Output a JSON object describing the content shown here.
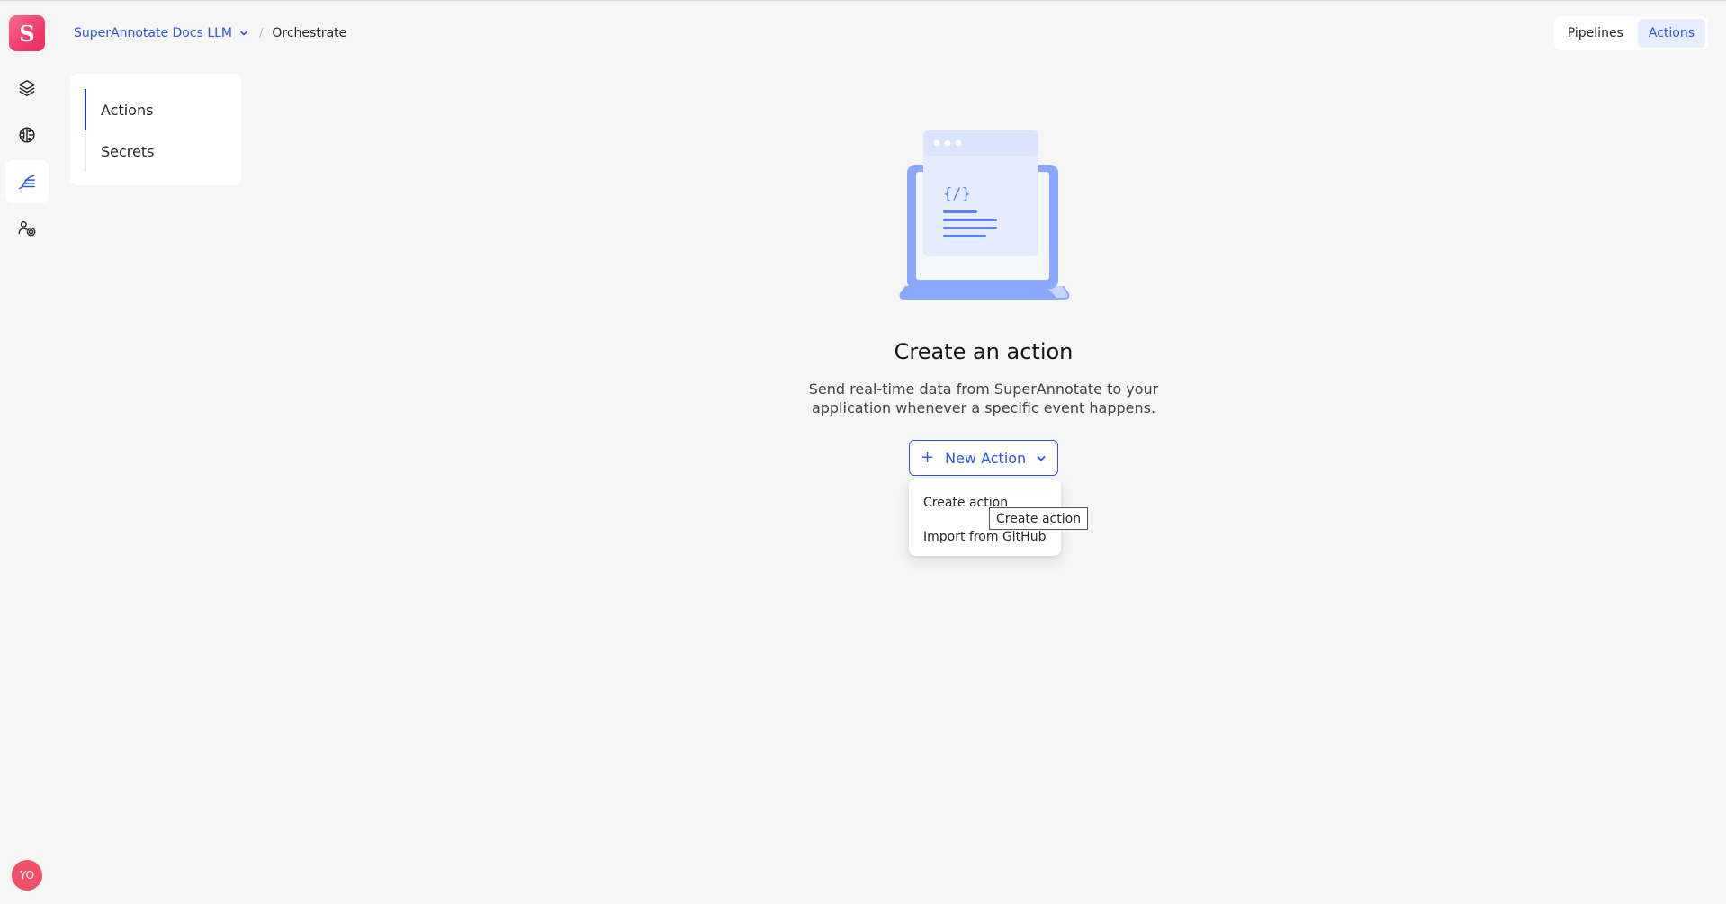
{
  "app": {
    "logo_letter": "S",
    "brand_color": "#2f54eb",
    "logo_gradient": [
      "#ff6b8e",
      "#e8335f"
    ]
  },
  "rail": {
    "items": [
      {
        "name": "layers-icon",
        "active": false
      },
      {
        "name": "brain-icon",
        "active": false
      },
      {
        "name": "orchestrate-icon",
        "active": true
      },
      {
        "name": "team-settings-icon",
        "active": false
      }
    ],
    "avatar_initials": "YO"
  },
  "breadcrumb": {
    "project": "SuperAnnotate Docs LLM",
    "separator": "/",
    "current": "Orchestrate"
  },
  "top_toggle": {
    "pipelines": "Pipelines",
    "actions": "Actions",
    "selected": "Actions"
  },
  "side_menu": {
    "items": [
      {
        "label": "Actions",
        "active": true
      },
      {
        "label": "Secrets",
        "active": false
      }
    ]
  },
  "empty_state": {
    "illustration_icon": "laptop-code-icon",
    "code_glyph": "{/}",
    "title": "Create an action",
    "description": "Send real-time data from SuperAnnotate to your application whenever a specific event happens."
  },
  "new_action": {
    "label": "New Action",
    "menu": [
      "Create action",
      "Import from GitHub"
    ]
  },
  "tooltip": "Create action"
}
